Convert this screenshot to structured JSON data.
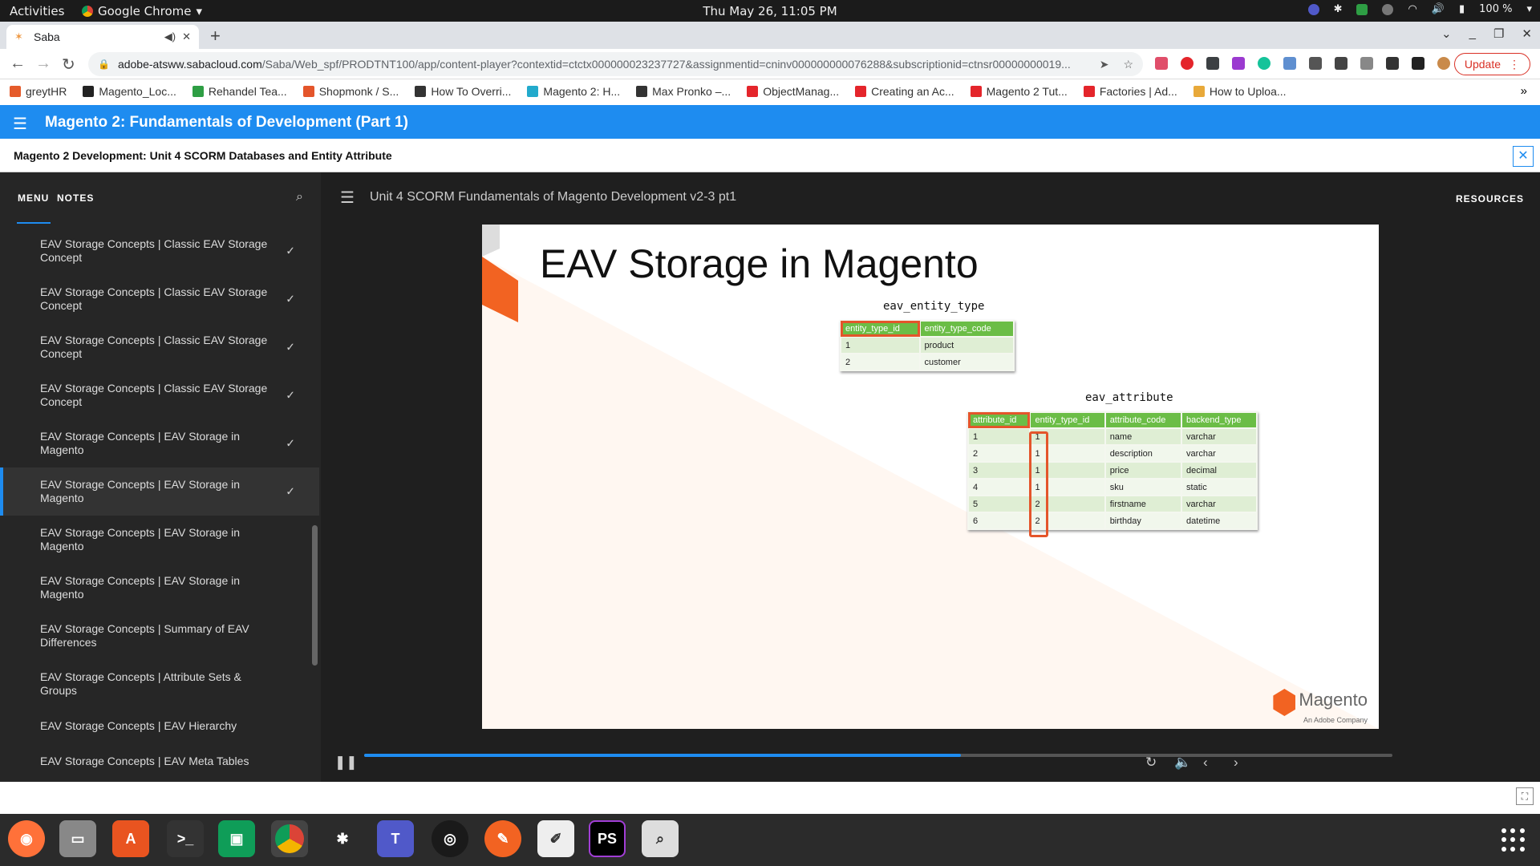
{
  "topbar": {
    "activities": "Activities",
    "app_name": "Google Chrome",
    "clock": "Thu May 26, 11:05 PM",
    "battery": "100 %"
  },
  "browser": {
    "tab_title": "Saba",
    "url_host": "adobe-atsww.sabacloud.com",
    "url_path": "/Saba/Web_spf/PRODTNT100/app/content-player?contextid=ctctx000000023237727&assignmentid=cninv000000000076288&subscriptionid=ctnsr00000000019...",
    "update_label": "Update",
    "bookmarks": [
      {
        "label": "greytHR",
        "color": "#e55b2b"
      },
      {
        "label": "Magento_Loc...",
        "color": "#222222"
      },
      {
        "label": "Rehandel Tea...",
        "color": "#2e9e44"
      },
      {
        "label": "Shopmonk / S...",
        "color": "#e4552b"
      },
      {
        "label": "How To Overri...",
        "color": "#333333"
      },
      {
        "label": "Magento 2: H...",
        "color": "#22aacc"
      },
      {
        "label": "Max Pronko –...",
        "color": "#333333"
      },
      {
        "label": "ObjectManag...",
        "color": "#e4252b"
      },
      {
        "label": "Creating an Ac...",
        "color": "#e4252b"
      },
      {
        "label": "Magento 2 Tut...",
        "color": "#e4252b"
      },
      {
        "label": "Factories | Ad...",
        "color": "#e4252b"
      },
      {
        "label": "How to Uploa...",
        "color": "#e8a93a"
      }
    ]
  },
  "course": {
    "title": "Magento 2: Fundamentals of Development (Part 1)",
    "subtitle": "Magento 2 Development: Unit 4 SCORM Databases and Entity Attribute"
  },
  "sidebar": {
    "menu_tab": "MENU",
    "notes_tab": "NOTES",
    "items": [
      {
        "label": "EAV Storage Concepts | Classic EAV Storage Concept",
        "checked": true
      },
      {
        "label": "EAV Storage Concepts | Classic EAV Storage Concept",
        "checked": true
      },
      {
        "label": "EAV Storage Concepts | Classic EAV Storage Concept",
        "checked": true
      },
      {
        "label": "EAV Storage Concepts | Classic EAV Storage Concept",
        "checked": true
      },
      {
        "label": "EAV Storage Concepts | EAV Storage in Magento",
        "checked": true
      },
      {
        "label": "EAV Storage Concepts | EAV Storage in Magento",
        "checked": true,
        "active": true
      },
      {
        "label": "EAV Storage Concepts | EAV Storage in Magento",
        "checked": false
      },
      {
        "label": "EAV Storage Concepts | EAV Storage in Magento",
        "checked": false
      },
      {
        "label": "EAV Storage Concepts | Summary of EAV Differences",
        "checked": false
      },
      {
        "label": "EAV Storage Concepts | Attribute Sets & Groups",
        "checked": false
      },
      {
        "label": "EAV Storage Concepts | EAV Hierarchy",
        "checked": false
      },
      {
        "label": "EAV Storage Concepts | EAV Meta Tables",
        "checked": false
      }
    ]
  },
  "player": {
    "unit_title": "Unit 4 SCORM Fundamentals of Magento Development v2-3 pt1",
    "resources": "RESOURCES",
    "progress": 0.58
  },
  "slide": {
    "title": "EAV Storage in Magento",
    "entity_type_table": {
      "name": "eav_entity_type",
      "headers": [
        "entity_type_id",
        "entity_type_code"
      ],
      "rows": [
        [
          "1",
          "product"
        ],
        [
          "2",
          "customer"
        ]
      ]
    },
    "attribute_table": {
      "name": "eav_attribute",
      "headers": [
        "attribute_id",
        "entity_type_id",
        "attribute_code",
        "backend_type"
      ],
      "rows": [
        [
          "1",
          "1",
          "name",
          "varchar"
        ],
        [
          "2",
          "1",
          "description",
          "varchar"
        ],
        [
          "3",
          "1",
          "price",
          "decimal"
        ],
        [
          "4",
          "1",
          "sku",
          "static"
        ],
        [
          "5",
          "2",
          "firstname",
          "varchar"
        ],
        [
          "6",
          "2",
          "birthday",
          "datetime"
        ]
      ]
    },
    "logo_name": "Magento",
    "logo_tagline": "An Adobe Company"
  },
  "colors": {
    "accent": "#1e8cf0",
    "magento_orange": "#f26322",
    "table_green": "#6bbd46",
    "highlight_red": "#e4552b"
  }
}
